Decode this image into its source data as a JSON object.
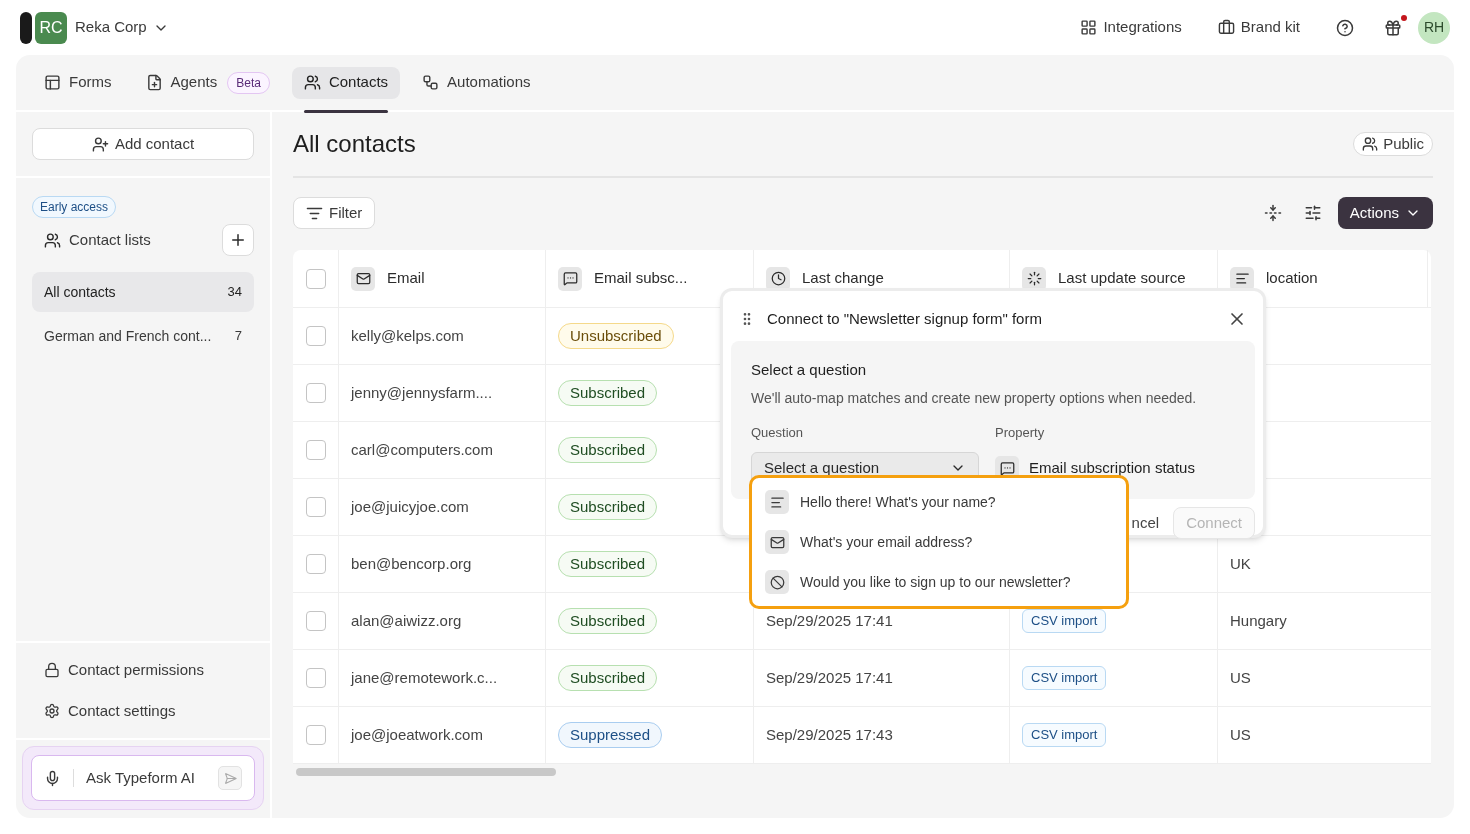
{
  "workspace": {
    "initials": "RC",
    "name": "Reka Corp"
  },
  "top_links": [
    {
      "label": "Integrations",
      "kind": "integrations"
    },
    {
      "label": "Brand kit",
      "kind": "brand"
    }
  ],
  "gift": {
    "has_notification": true
  },
  "user": {
    "initials": "RH"
  },
  "tabs": [
    {
      "label": "Forms",
      "kind": "forms",
      "selected": false
    },
    {
      "label": "Agents",
      "kind": "agents",
      "badge": "Beta",
      "selected": false
    },
    {
      "label": "Contacts",
      "kind": "contacts",
      "selected": true
    },
    {
      "label": "Automations",
      "kind": "automations",
      "selected": false
    }
  ],
  "sidebar": {
    "add_contact": "Add contact",
    "early_access": "Early access",
    "lists_label": "Contact lists",
    "lists": [
      {
        "name": "All contacts",
        "count": "34",
        "selected": true
      },
      {
        "name": "German and French cont...",
        "count": "7",
        "selected": false
      }
    ],
    "footer_links": [
      {
        "label": "Contact permissions",
        "kind": "lock"
      },
      {
        "label": "Contact settings",
        "kind": "settings"
      }
    ],
    "ai_input": {
      "placeholder": "Ask Typeform AI"
    }
  },
  "content": {
    "title": "All contacts",
    "visibility": "Public",
    "filter": "Filter",
    "actions": "Actions",
    "table": {
      "header_checked": false,
      "columns": [
        {
          "label": "Email",
          "kind": "email"
        },
        {
          "label": "Email subsc...",
          "kind": "subscription"
        },
        {
          "label": "Last change",
          "kind": "date"
        },
        {
          "label": "Last update source",
          "kind": "source"
        },
        {
          "label": "location",
          "kind": "text"
        }
      ],
      "rows": [
        {
          "checked": false,
          "email": "kelly@kelps.com",
          "subscription": {
            "label": "Unsubscribed",
            "kind": "unsubscribed"
          }
        },
        {
          "checked": false,
          "email": "jenny@jennysfarm....",
          "subscription": {
            "label": "Subscribed",
            "kind": "subscribed"
          }
        },
        {
          "checked": false,
          "email": "carl@computers.com",
          "subscription": {
            "label": "Subscribed",
            "kind": "subscribed"
          }
        },
        {
          "checked": false,
          "email": "joe@juicyjoe.com",
          "subscription": {
            "label": "Subscribed",
            "kind": "subscribed"
          }
        },
        {
          "checked": false,
          "email": "ben@bencorp.org",
          "subscription": {
            "label": "Subscribed",
            "kind": "subscribed"
          },
          "location": "UK"
        },
        {
          "checked": false,
          "email": "alan@aiwizz.org",
          "subscription": {
            "label": "Subscribed",
            "kind": "subscribed"
          },
          "last_change": "Sep/29/2025 17:41",
          "source": "CSV import",
          "location": "Hungary"
        },
        {
          "checked": false,
          "email": "jane@remotework.c...",
          "subscription": {
            "label": "Subscribed",
            "kind": "subscribed"
          },
          "last_change": "Sep/29/2025 17:41",
          "source": "CSV import",
          "location": "US"
        },
        {
          "checked": false,
          "email": "joe@joeatwork.com",
          "subscription": {
            "label": "Suppressed",
            "kind": "suppressed"
          },
          "last_change": "Sep/29/2025 17:43",
          "source": "CSV import",
          "location": "US"
        }
      ]
    }
  },
  "popup": {
    "title": "Connect to \"Newsletter signup form\" form",
    "section_title": "Select a question",
    "description": "We'll auto-map matches and create new property options when needed.",
    "question_label": "Question",
    "property_label": "Property",
    "select_placeholder": "Select a question",
    "property": "Email subscription status",
    "cancel": "ncel",
    "connect": {
      "label": "Connect",
      "disabled": true
    },
    "options": [
      {
        "label": "Hello there! What's your name?",
        "kind": "short_text"
      },
      {
        "label": "What's your email address?",
        "kind": "email"
      },
      {
        "label": "Would you like to sign up to our newsletter?",
        "kind": "yes_no"
      }
    ]
  }
}
